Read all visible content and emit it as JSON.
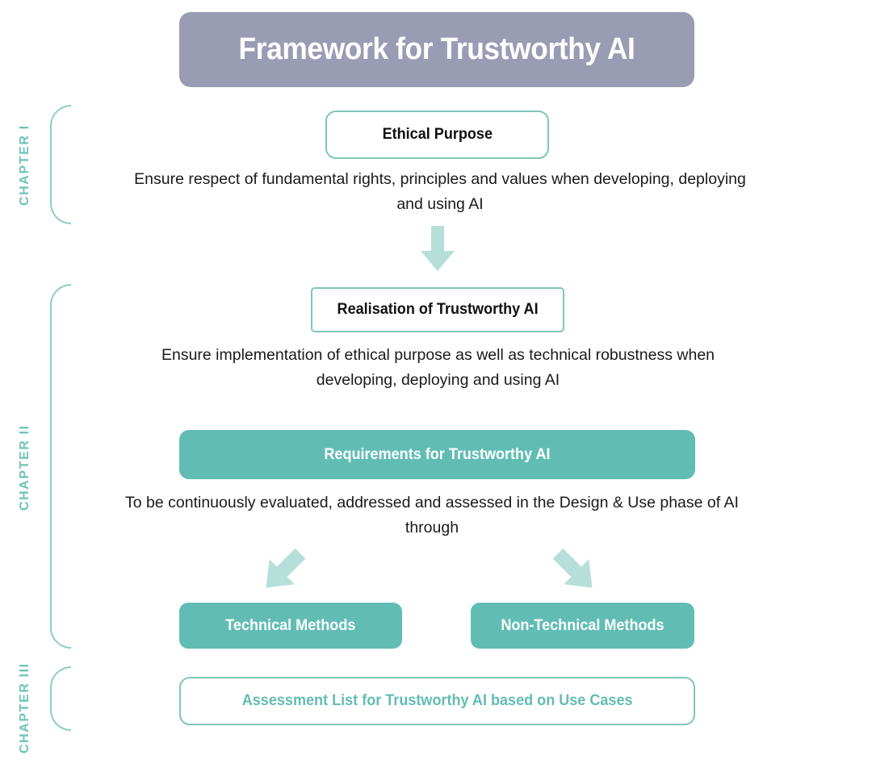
{
  "header": {
    "title": "Framework for Trustworthy AI"
  },
  "colors": {
    "title_banner": "#9a9cb4",
    "teal_fill": "#61bdb4",
    "teal_border": "#7ec6bb",
    "teal_text": "#63bdb3",
    "arrow_light_teal": "#b7dfd9",
    "background": "#ffffff",
    "body_text": "#1a1a1a"
  },
  "chapters": [
    {
      "label": "CHAPTER I"
    },
    {
      "label": "CHAPTER II"
    },
    {
      "label": "CHAPTER III"
    }
  ],
  "nodes": {
    "ethical_purpose": "Ethical Purpose",
    "realisation": "Realisation of Trustworthy AI",
    "requirements": "Requirements for Trustworthy AI",
    "technical_methods": "Technical Methods",
    "non_technical_methods": "Non-Technical Methods",
    "assessment_list": "Assessment List for Trustworthy AI based on Use Cases"
  },
  "captions": {
    "ethical_purpose": "Ensure respect of fundamental rights, principles and values when developing, deploying and using AI",
    "realisation": "Ensure implementation of ethical purpose as well as technical robustness when developing, deploying and using AI",
    "requirements": "To be continuously evaluated, addressed and assessed in the Design & Use phase of AI through"
  },
  "arrows": {
    "down": "arrow-down-icon",
    "down_left": "arrow-down-left-icon",
    "down_right": "arrow-down-right-icon"
  },
  "chart_data": {
    "type": "diagram",
    "title": "Framework for Trustworthy AI",
    "nodes": [
      {
        "id": "ethical_purpose",
        "label": "Ethical Purpose",
        "chapter": "CHAPTER I",
        "style": "outline"
      },
      {
        "id": "realisation",
        "label": "Realisation of Trustworthy AI",
        "chapter": "CHAPTER II",
        "style": "outline"
      },
      {
        "id": "requirements",
        "label": "Requirements for Trustworthy AI",
        "chapter": "CHAPTER II",
        "style": "filled"
      },
      {
        "id": "technical_methods",
        "label": "Technical Methods",
        "chapter": "CHAPTER II",
        "style": "filled"
      },
      {
        "id": "non_technical_methods",
        "label": "Non-Technical Methods",
        "chapter": "CHAPTER II",
        "style": "filled"
      },
      {
        "id": "assessment_list",
        "label": "Assessment List for Trustworthy AI based on Use Cases",
        "chapter": "CHAPTER III",
        "style": "outline"
      }
    ],
    "edges": [
      {
        "from": "ethical_purpose",
        "to": "realisation",
        "direction": "down"
      },
      {
        "from": "requirements",
        "to": "technical_methods",
        "direction": "down-left"
      },
      {
        "from": "requirements",
        "to": "non_technical_methods",
        "direction": "down-right"
      }
    ]
  }
}
